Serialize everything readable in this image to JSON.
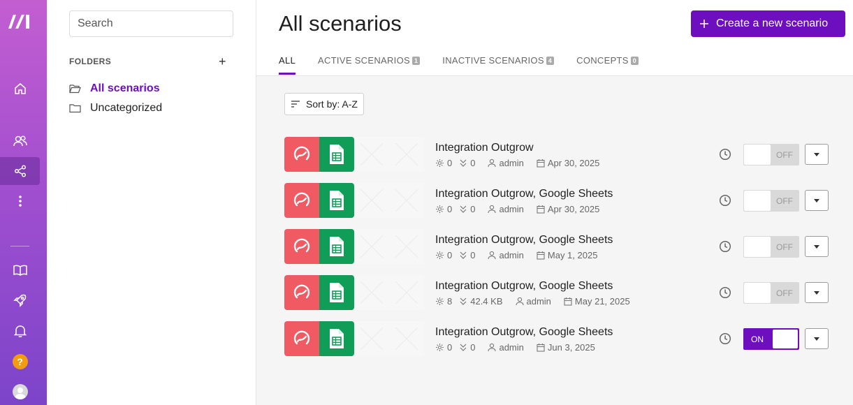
{
  "sidebar": {
    "nav": [
      {
        "icon": "home-icon"
      },
      {
        "icon": "users-icon"
      },
      {
        "icon": "share-icon",
        "active": true
      },
      {
        "icon": "more-vertical-icon"
      },
      {
        "icon": "book-icon"
      },
      {
        "icon": "rocket-icon"
      },
      {
        "icon": "bell-icon"
      }
    ],
    "help_label": "?"
  },
  "folders_panel": {
    "search_placeholder": "Search",
    "heading": "FOLDERS",
    "add_label": "+",
    "items": [
      {
        "label": "All scenarios",
        "active": true
      },
      {
        "label": "Uncategorized",
        "active": false
      }
    ]
  },
  "header": {
    "title": "All scenarios",
    "create_button": "Create a new scenario",
    "tabs": [
      {
        "label": "ALL",
        "count": null,
        "active": true
      },
      {
        "label": "ACTIVE SCENARIOS",
        "count": "1"
      },
      {
        "label": "INACTIVE SCENARIOS",
        "count": "4"
      },
      {
        "label": "CONCEPTS",
        "count": "0"
      }
    ]
  },
  "sort": {
    "label": "Sort by: A-Z"
  },
  "scenarios": [
    {
      "name": "Integration Outgrow",
      "ops": "0",
      "data": "0",
      "owner": "admin",
      "date": "Apr 30, 2025",
      "status": "OFF"
    },
    {
      "name": "Integration Outgrow, Google Sheets",
      "ops": "0",
      "data": "0",
      "owner": "admin",
      "date": "Apr 30, 2025",
      "status": "OFF"
    },
    {
      "name": "Integration Outgrow, Google Sheets",
      "ops": "0",
      "data": "0",
      "owner": "admin",
      "date": "May 1, 2025",
      "status": "OFF"
    },
    {
      "name": "Integration Outgrow, Google Sheets",
      "ops": "8",
      "data": "42.4 KB",
      "owner": "admin",
      "date": "May 21, 2025",
      "status": "OFF"
    },
    {
      "name": "Integration Outgrow, Google Sheets",
      "ops": "0",
      "data": "0",
      "owner": "admin",
      "date": "Jun 3, 2025",
      "status": "ON"
    }
  ],
  "colors": {
    "brand": "#6d0fbe",
    "outgrow": "#f05a63",
    "sheets": "#0f9d58"
  }
}
